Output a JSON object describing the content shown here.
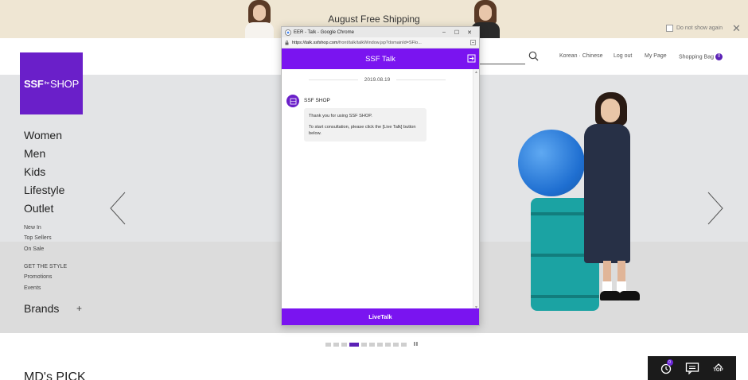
{
  "banner": {
    "title": "August Free Shipping",
    "do_not_show_again": "Do not show again"
  },
  "header": {
    "logo_text": "SSF",
    "logo_small": "SHOP",
    "links": {
      "language": "Korean · Chinese",
      "logout": "Log out",
      "mypage": "My Page",
      "bag": "Shopping Bag",
      "bag_count": "0"
    }
  },
  "nav": {
    "main": [
      "Women",
      "Men",
      "Kids",
      "Lifestyle",
      "Outlet"
    ],
    "sub": [
      "New In",
      "Top Sellers",
      "On Sale"
    ],
    "style_header": "GET THE STYLE",
    "style_links": [
      "Promotions",
      "Events"
    ],
    "brands": "Brands",
    "brands_toggle": "+"
  },
  "hero": {
    "slide_count": 10,
    "active_slide": 4,
    "pause_label": "II"
  },
  "section": {
    "mdpick_title": "MD's PICK"
  },
  "floating": {
    "history_badge": "0",
    "top_label": "TOP"
  },
  "popup": {
    "window_title": "EER - Talk - Google Chrome",
    "window_controls": [
      "–",
      "☐",
      "✕"
    ],
    "url_host": "https://talk.ssfshop.com",
    "url_path": "/front/talk/talkWindow.jsp?domainId=SFlo...",
    "header_title": "SSF Talk",
    "date": "2019.08.19",
    "bot_name": "SSF SHOP",
    "message_line1": "Thank you for using SSF SHOP.",
    "message_line2": "To start consultation, please click the [Live Talk] button below.",
    "livetalk_button": "LiveTalk"
  },
  "colors": {
    "brand_purple": "#6a1fc9",
    "talk_purple": "#7a14f0",
    "banner_bg": "#efe6d3"
  }
}
